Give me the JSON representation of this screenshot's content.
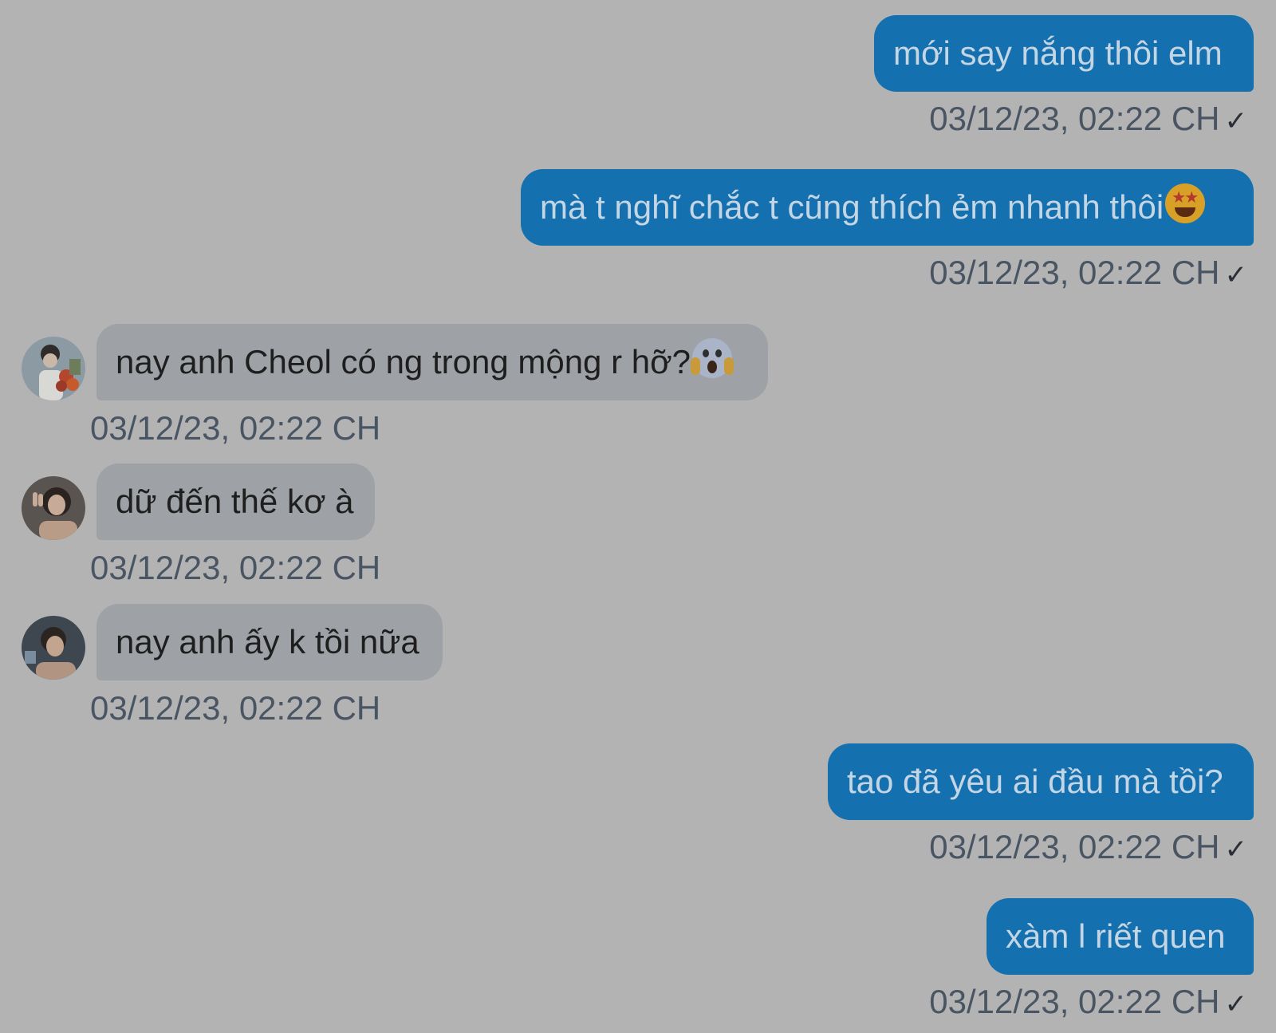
{
  "messages": [
    {
      "direction": "sent",
      "text": "mới say nắng thôi elm",
      "time": "03/12/23, 02:22 CH",
      "status": "✓"
    },
    {
      "direction": "sent",
      "text": "mà t nghĩ chắc t cũng thích ẻm nhanh thôi",
      "emoji": "star-struck-emoji",
      "time": "03/12/23, 02:22 CH",
      "status": "✓"
    },
    {
      "direction": "received",
      "text": "nay anh Cheol có ng trong mộng r hỡ?",
      "emoji": "screaming-face-emoji",
      "time": "03/12/23, 02:22 CH",
      "avatar": "avatar-with-flowers"
    },
    {
      "direction": "received",
      "text": "dữ đến thế kơ à",
      "time": "03/12/23, 02:22 CH",
      "avatar": "avatar-peace-sign"
    },
    {
      "direction": "received",
      "text": "nay anh ấy k tồi nữa",
      "time": "03/12/23, 02:22 CH",
      "avatar": "avatar-man"
    },
    {
      "direction": "sent",
      "text": "tao đã yêu ai đầu mà tồi?",
      "time": "03/12/23, 02:22 CH",
      "status": "✓"
    },
    {
      "direction": "sent",
      "text": "xàm l riết quen",
      "time": "03/12/23, 02:22 CH",
      "status": "✓"
    }
  ],
  "colors": {
    "background": "#b3b3b3",
    "sent_bubble": "#1570af",
    "received_bubble": "#9ea1a5",
    "timestamp": "#4a5564"
  }
}
